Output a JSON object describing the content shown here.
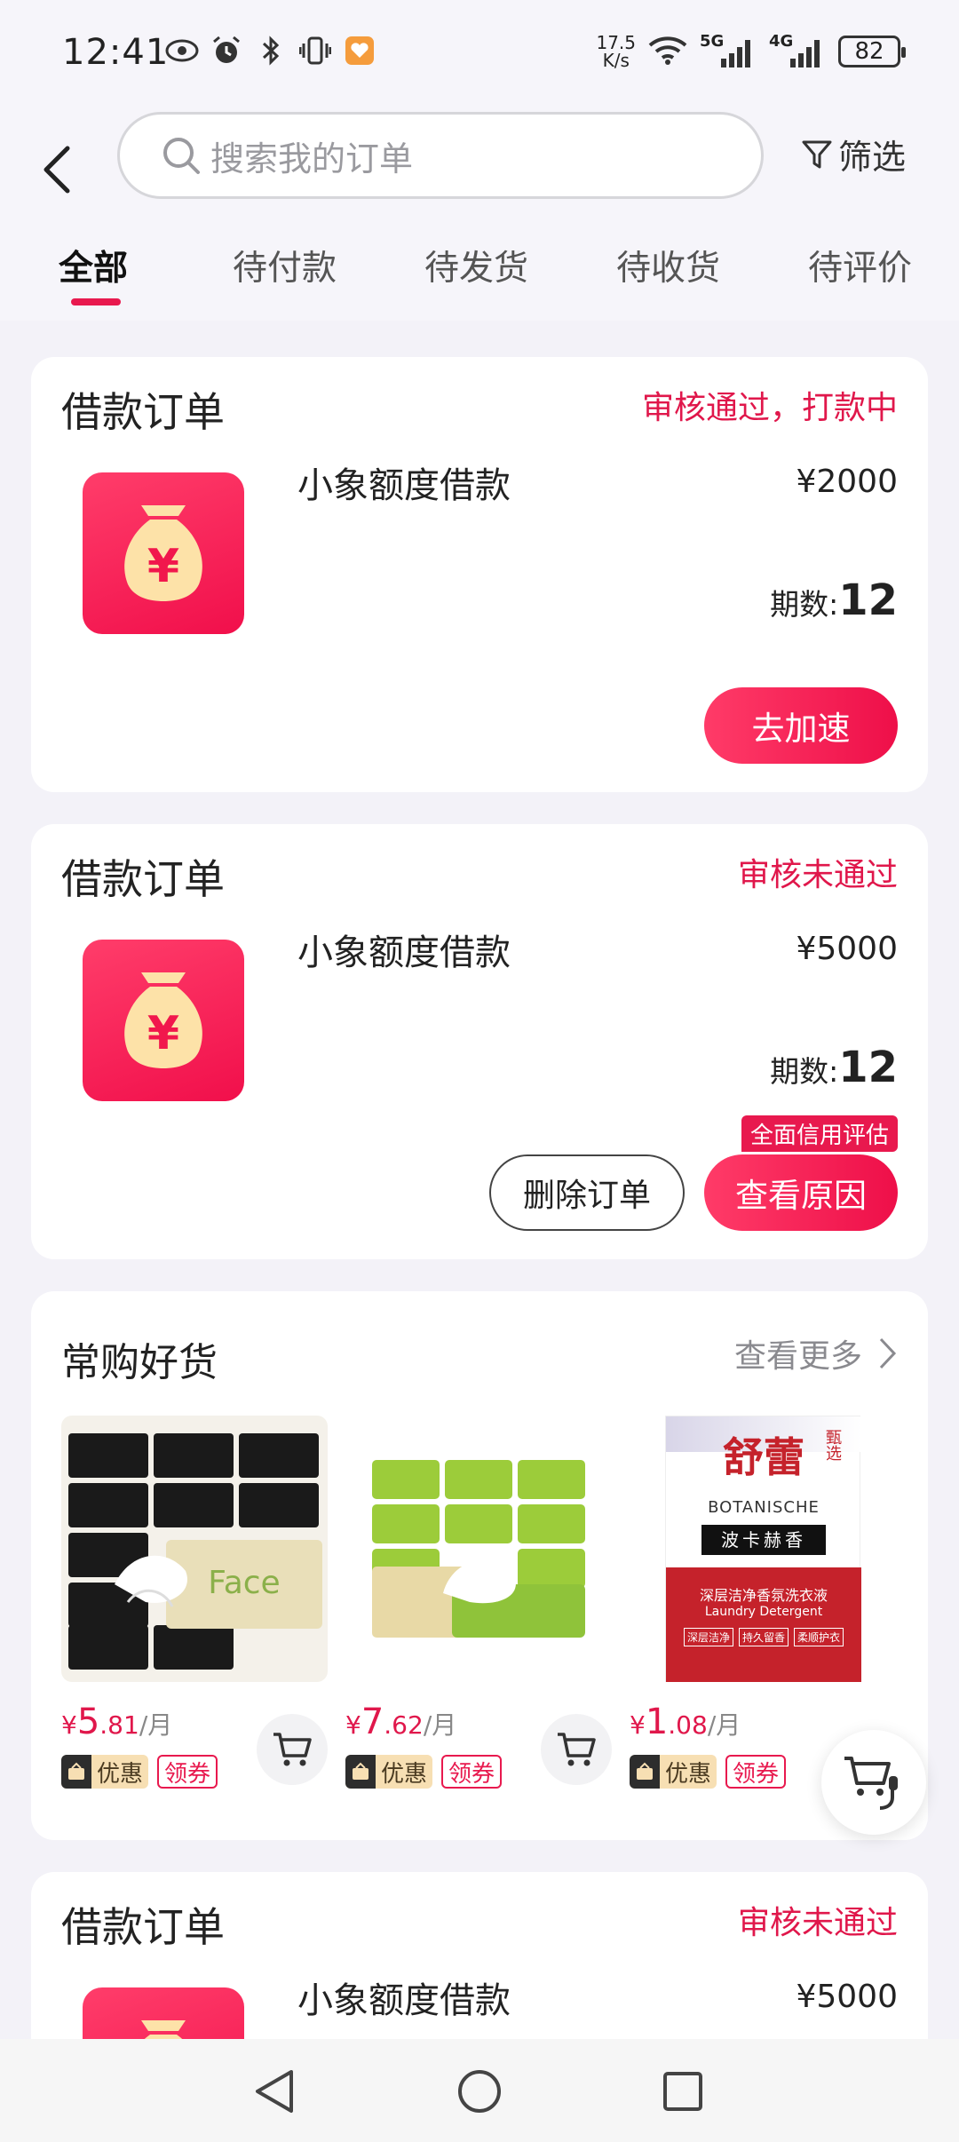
{
  "status_bar": {
    "time": "12:41",
    "net_speed_value": "17.5",
    "net_speed_unit": "K/s",
    "net1": "5G",
    "net2": "4G",
    "battery": "82"
  },
  "search": {
    "placeholder": "搜索我的订单"
  },
  "filter_label": "筛选",
  "tabs": [
    "全部",
    "待付款",
    "待发货",
    "待收货",
    "待评价"
  ],
  "active_tab": 0,
  "orders": [
    {
      "title": "借款订单",
      "status": "审核通过，打款中",
      "name": "小象额度借款",
      "price": "¥2000",
      "periods_label": "期数:",
      "periods_value": "12",
      "button": "去加速"
    },
    {
      "title": "借款订单",
      "status": "审核未通过",
      "name": "小象额度借款",
      "price": "¥5000",
      "periods_label": "期数:",
      "periods_value": "12",
      "tag": "全面信用评估",
      "delete_button": "删除订单",
      "reason_button": "查看原因"
    },
    {
      "title": "借款订单",
      "status": "审核未通过",
      "name": "小象额度借款",
      "price": "¥5000"
    }
  ],
  "goods": {
    "title": "常购好货",
    "more": "查看更多",
    "items": [
      {
        "currency": "¥",
        "int": "5",
        "dec": ".81",
        "per": "/月",
        "youhui": "优惠",
        "lingquan": "领券",
        "kind": "tissue-black"
      },
      {
        "currency": "¥",
        "int": "7",
        "dec": ".62",
        "per": "/月",
        "youhui": "优惠",
        "lingquan": "领券",
        "kind": "tissue-green"
      },
      {
        "currency": "¥",
        "int": "1",
        "dec": ".08",
        "per": "/月",
        "youhui": "优惠",
        "lingquan": "领券",
        "kind": "detergent"
      }
    ],
    "img_text": {
      "face": "Face",
      "brand_cn": "舒蕾",
      "brand_cn_sub": "甄选",
      "brand_en": "BOTANISCHE",
      "product_cn": "波卡赫香",
      "product_desc": "深层洁净香氛洗衣液",
      "product_en": "Laundry Detergent",
      "feature1": "深层洁净",
      "feature2": "持久留香",
      "feature3": "柔顺护衣"
    }
  },
  "colors": {
    "accent": "#e8194e",
    "background": "#f3f2f8"
  }
}
